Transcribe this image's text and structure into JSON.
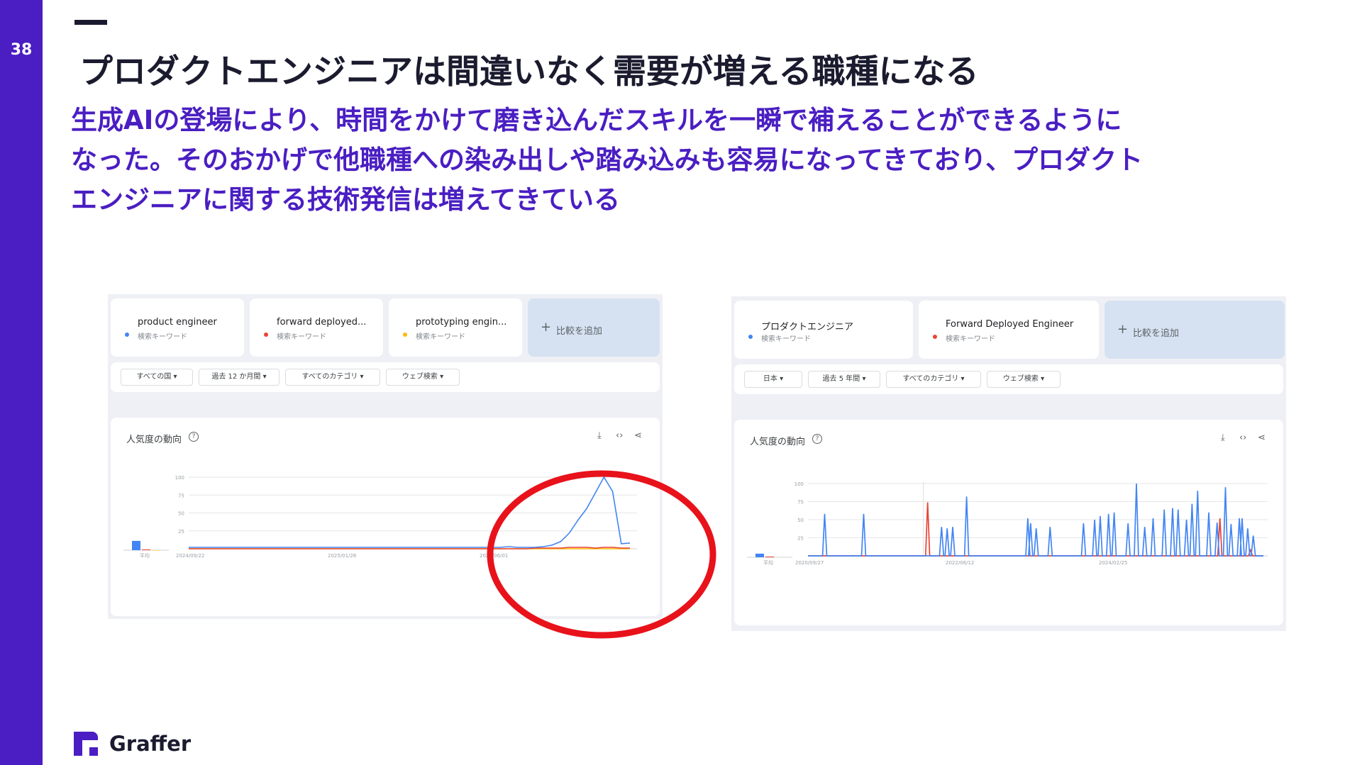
{
  "slide": {
    "page_number": "38",
    "title": "プロダクトエンジニアは間違いなく需要が増える職種になる",
    "subtitle_lines": [
      "生成AIの登場により、時間をかけて磨き込んだスキルを一瞬で補えることができるように",
      "なった。そのおかげで他職種への染み出しや踏み込みも容易になってきており、プロダクト",
      "エンジニアに関する技術発信は増えてきている"
    ],
    "brand": "Graffer"
  },
  "colors": {
    "accent": "#4a1ec2",
    "title": "#1b1b2f",
    "series_blue": "#4285f4",
    "series_red": "#ea4335",
    "series_yellow": "#fbbc04",
    "highlight_circle": "#e8121b"
  },
  "trends_left": {
    "keywords": [
      {
        "name": "product engineer",
        "sub": "検索キーワード",
        "color": "#4285f4"
      },
      {
        "name": "forward deployed...",
        "sub": "検索キーワード",
        "color": "#ea4335"
      },
      {
        "name": "prototyping engin...",
        "sub": "検索キーワード",
        "color": "#fbbc04"
      }
    ],
    "add_compare": "比較を追加",
    "filters": [
      "すべての国",
      "過去 12 か月間",
      "すべてのカテゴリ",
      "ウェブ検索"
    ],
    "chart_title": "人気度の動向",
    "help_icon": "?",
    "tools": [
      "download-icon",
      "embed-icon",
      "share-icon"
    ],
    "avg_label": "平均",
    "y_ticks": [
      "100",
      "75",
      "50",
      "25"
    ],
    "x_ticks": [
      "2024/09/22",
      "2025/01/26",
      "2025/06/01"
    ]
  },
  "trends_right": {
    "keywords": [
      {
        "name": "プロダクトエンジニア",
        "sub": "検索キーワード",
        "color": "#4285f4"
      },
      {
        "name": "Forward Deployed Engineer",
        "sub": "検索キーワード",
        "color": "#ea4335"
      }
    ],
    "add_compare": "比較を追加",
    "filters": [
      "日本",
      "過去 5 年間",
      "すべてのカテゴリ",
      "ウェブ検索"
    ],
    "chart_title": "人気度の動向",
    "help_icon": "?",
    "tools": [
      "download-icon",
      "embed-icon",
      "share-icon"
    ],
    "avg_label": "平均",
    "y_ticks": [
      "100",
      "75",
      "50",
      "25"
    ],
    "x_ticks": [
      "2020/09/27",
      "2022/06/12",
      "2024/02/25"
    ]
  },
  "chart_data": [
    {
      "type": "line",
      "ylim": [
        0,
        100
      ],
      "series": [
        {
          "name": "product engineer",
          "values": [
            2,
            2,
            2,
            2,
            2,
            2,
            2,
            2,
            2,
            2,
            2,
            2,
            2,
            2,
            2,
            2,
            2,
            2,
            2,
            2,
            2,
            2,
            2,
            2,
            2,
            2,
            2,
            2,
            2,
            2,
            2,
            2,
            2,
            2,
            2,
            2,
            2,
            3,
            2,
            2,
            2,
            3,
            5,
            10,
            22,
            40,
            56,
            78,
            100,
            80,
            7,
            8
          ]
        },
        {
          "name": "forward deployed...",
          "values": [
            0,
            0,
            0,
            0,
            0,
            0,
            0,
            0,
            0,
            0,
            0,
            0,
            0,
            0,
            0,
            0,
            0,
            0,
            0,
            0,
            0,
            0,
            0,
            0,
            0,
            0,
            0,
            0,
            0,
            0,
            0,
            0,
            0,
            0,
            0,
            0,
            0,
            0,
            0,
            0,
            1,
            1,
            1,
            1,
            2,
            2,
            2,
            1,
            2,
            2,
            1,
            1
          ]
        },
        {
          "name": "prototyping engin...",
          "values": [
            0,
            0,
            0,
            0,
            0,
            0,
            0,
            0,
            0,
            0,
            0,
            0,
            0,
            0,
            0,
            0,
            0,
            0,
            0,
            0,
            0,
            0,
            0,
            0,
            0,
            0,
            0,
            0,
            0,
            0,
            0,
            0,
            0,
            0,
            0,
            0,
            0,
            0,
            0,
            0,
            0,
            0,
            0,
            0,
            0,
            0,
            0,
            0,
            0,
            0,
            0,
            0
          ]
        }
      ],
      "averages": [
        13,
        1,
        0
      ]
    },
    {
      "type": "line",
      "ylim": [
        0,
        100
      ],
      "series": [
        {
          "name": "プロダクトエンジニア",
          "values": [
            0,
            0,
            0,
            0,
            0,
            0,
            0,
            0,
            0,
            0,
            0,
            0,
            0,
            0,
            0,
            0,
            0,
            0,
            0,
            0,
            0,
            0,
            0,
            0,
            0,
            0,
            0,
            0,
            0,
            0,
            0,
            0,
            0,
            0,
            0,
            0,
            58,
            0,
            0,
            0,
            0,
            0,
            0,
            0,
            0,
            0,
            0,
            0,
            0,
            0,
            0,
            0,
            0,
            0,
            0,
            0,
            0,
            0,
            0,
            0,
            0,
            0,
            0,
            0,
            0,
            0,
            0,
            0,
            0,
            0,
            0,
            0,
            0,
            0,
            0,
            0,
            0,
            0,
            0,
            0,
            0,
            0,
            0,
            0,
            0,
            0,
            0,
            0,
            0,
            0,
            0,
            0,
            0,
            0,
            0,
            0,
            0,
            0,
            0,
            0,
            0,
            0,
            0,
            0,
            0,
            0,
            0,
            0,
            0,
            0,
            0,
            0,
            0,
            0,
            0,
            0,
            0,
            0,
            0,
            0,
            0,
            0,
            0,
            0,
            0,
            0,
            0,
            0,
            0,
            0,
            0,
            0,
            0,
            0,
            0,
            0,
            0,
            0,
            0,
            0,
            0,
            0,
            0,
            0,
            0,
            0,
            0,
            0,
            0,
            0,
            0,
            0,
            0,
            0,
            0,
            0,
            0,
            0,
            0,
            0,
            0,
            0,
            0,
            0,
            0,
            0,
            0,
            0,
            0,
            0,
            0,
            0,
            0,
            0,
            0,
            0,
            0,
            0,
            0,
            0,
            0,
            0,
            0,
            0,
            0,
            0,
            0,
            0,
            0,
            0,
            0,
            0,
            0,
            0,
            0,
            0,
            0,
            0,
            0,
            0,
            0,
            0,
            0,
            0,
            0,
            0,
            0,
            0,
            0,
            0,
            0,
            0,
            0,
            0,
            0,
            0,
            0,
            0,
            0,
            0,
            0,
            0,
            0,
            0,
            0,
            0,
            0,
            0,
            0,
            0,
            0,
            0,
            0,
            0,
            0,
            0,
            0,
            0,
            0,
            0,
            0,
            0,
            0,
            0,
            0,
            0,
            0,
            0,
            0,
            0,
            0,
            0,
            0,
            0,
            0,
            0,
            0,
            0,
            0,
            0,
            0,
            0,
            0,
            0,
            0,
            0,
            0,
            0,
            0,
            0,
            0
          ]
        },
        {
          "name": "Forward Deployed Engineer",
          "values": []
        }
      ],
      "spikes_blue": [
        [
          6,
          58
        ],
        [
          20,
          58
        ],
        [
          48,
          40
        ],
        [
          50,
          38
        ],
        [
          52,
          40
        ],
        [
          57,
          82
        ],
        [
          79,
          52
        ],
        [
          80,
          45
        ],
        [
          82,
          38
        ],
        [
          87,
          40
        ],
        [
          99,
          45
        ],
        [
          103,
          50
        ],
        [
          105,
          55
        ],
        [
          108,
          58
        ],
        [
          110,
          60
        ],
        [
          115,
          45
        ],
        [
          118,
          100
        ],
        [
          121,
          40
        ],
        [
          124,
          52
        ],
        [
          128,
          64
        ],
        [
          131,
          66
        ],
        [
          133,
          64
        ],
        [
          136,
          50
        ],
        [
          138,
          72
        ],
        [
          140,
          90
        ],
        [
          144,
          60
        ],
        [
          147,
          46
        ],
        [
          150,
          95
        ],
        [
          152,
          44
        ],
        [
          155,
          52
        ],
        [
          156,
          52
        ],
        [
          158,
          38
        ],
        [
          160,
          28
        ]
      ],
      "spikes_red": [
        [
          43,
          74
        ],
        [
          148,
          52
        ],
        [
          159,
          8
        ]
      ],
      "averages": [
        5,
        1
      ]
    }
  ]
}
